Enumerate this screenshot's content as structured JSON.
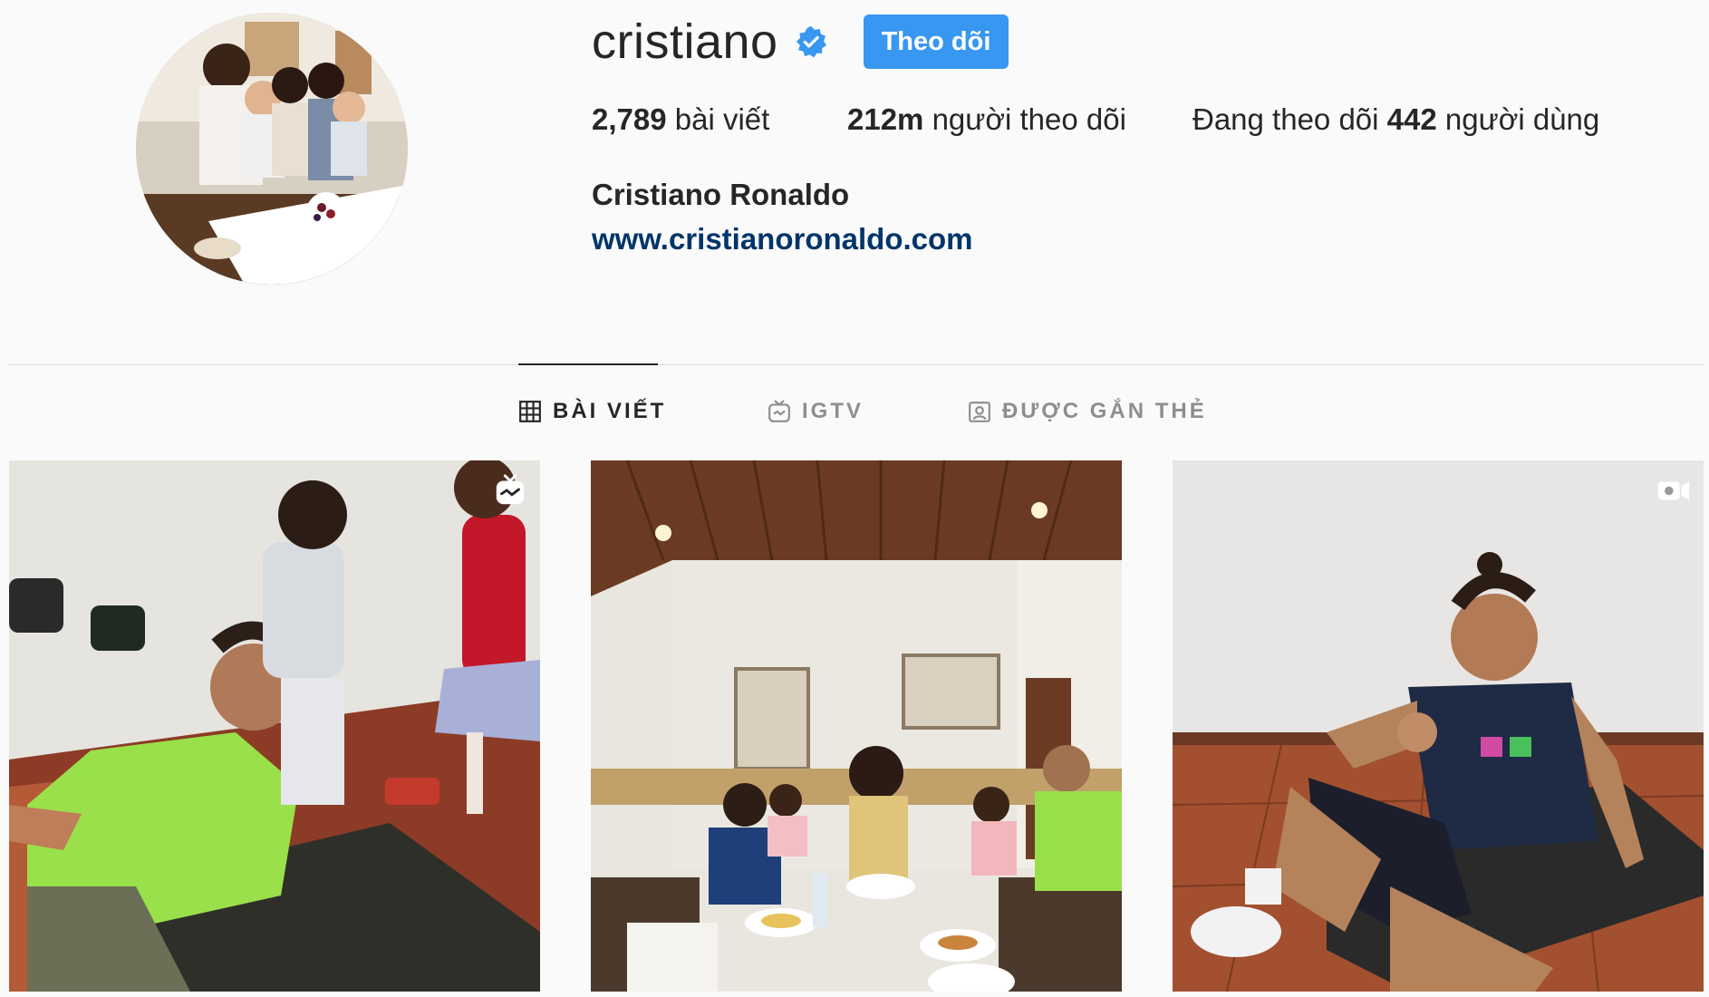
{
  "profile": {
    "username": "cristiano",
    "verified": true,
    "follow_label": "Theo dõi",
    "full_name": "Cristiano Ronaldo",
    "website": "www.cristianoronaldo.com"
  },
  "stats": {
    "posts_count": "2,789",
    "posts_label": "bài viết",
    "followers_count": "212m",
    "followers_label": "người theo dõi",
    "following_prefix": "Đang theo dõi",
    "following_count": "442",
    "following_suffix": "người dùng"
  },
  "tabs": [
    {
      "label": "BÀI VIẾT",
      "icon": "grid-icon",
      "active": true
    },
    {
      "label": "IGTV",
      "icon": "igtv-icon",
      "active": false
    },
    {
      "label": "ĐƯỢC GẮN THẺ",
      "icon": "tagged-icon",
      "active": false
    }
  ],
  "posts": [
    {
      "type": "igtv",
      "badge_icon": "igtv-badge-icon",
      "description": "workout with kids"
    },
    {
      "type": "image",
      "description": "family breakfast"
    },
    {
      "type": "video",
      "badge_icon": "video-camera-icon",
      "description": "thumbs up on mat"
    }
  ],
  "colors": {
    "accent": "#3897f0",
    "link": "#003569",
    "verified": "#3897f0",
    "muted": "#8e8e8e",
    "background": "#fafafa"
  }
}
